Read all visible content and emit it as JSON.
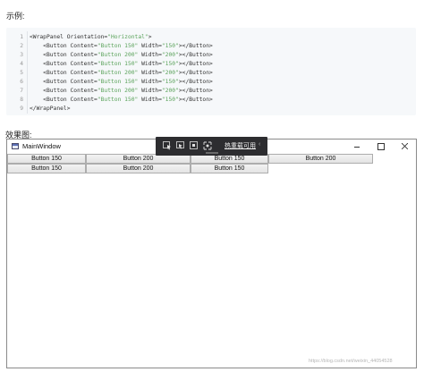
{
  "headings": {
    "example": "示例:",
    "effect": "效果图:"
  },
  "code": {
    "lines": [
      {
        "num": "1",
        "parts": [
          [
            "tag",
            "<WrapPanel "
          ],
          [
            "attr",
            "Orientation="
          ],
          [
            "str",
            "\"Horizontal\""
          ],
          [
            "tag",
            ">"
          ]
        ]
      },
      {
        "num": "2",
        "parts": [
          [
            "tag",
            "    <Button "
          ],
          [
            "attr",
            "Content="
          ],
          [
            "str",
            "\"Button 150\""
          ],
          [
            "attr",
            " Width="
          ],
          [
            "str",
            "\"150\""
          ],
          [
            "tag",
            "></Button>"
          ]
        ]
      },
      {
        "num": "3",
        "parts": [
          [
            "tag",
            "    <Button "
          ],
          [
            "attr",
            "Content="
          ],
          [
            "str",
            "\"Button 200\""
          ],
          [
            "attr",
            " Width="
          ],
          [
            "str",
            "\"200\""
          ],
          [
            "tag",
            "></Button>"
          ]
        ]
      },
      {
        "num": "4",
        "parts": [
          [
            "tag",
            "    <Button "
          ],
          [
            "attr",
            "Content="
          ],
          [
            "str",
            "\"Button 150\""
          ],
          [
            "attr",
            " Width="
          ],
          [
            "str",
            "\"150\""
          ],
          [
            "tag",
            "></Button>"
          ]
        ]
      },
      {
        "num": "5",
        "parts": [
          [
            "tag",
            "    <Button "
          ],
          [
            "attr",
            "Content="
          ],
          [
            "str",
            "\"Button 200\""
          ],
          [
            "attr",
            " Width="
          ],
          [
            "str",
            "\"200\""
          ],
          [
            "tag",
            "></Button>"
          ]
        ]
      },
      {
        "num": "6",
        "parts": [
          [
            "tag",
            "    <Button "
          ],
          [
            "attr",
            "Content="
          ],
          [
            "str",
            "\"Button 150\""
          ],
          [
            "attr",
            " Width="
          ],
          [
            "str",
            "\"150\""
          ],
          [
            "tag",
            "></Button>"
          ]
        ]
      },
      {
        "num": "7",
        "parts": [
          [
            "tag",
            "    <Button "
          ],
          [
            "attr",
            "Content="
          ],
          [
            "str",
            "\"Button 200\""
          ],
          [
            "attr",
            " Width="
          ],
          [
            "str",
            "\"200\""
          ],
          [
            "tag",
            "></Button>"
          ]
        ]
      },
      {
        "num": "8",
        "parts": [
          [
            "tag",
            "    <Button "
          ],
          [
            "attr",
            "Content="
          ],
          [
            "str",
            "\"Button 150\""
          ],
          [
            "attr",
            " Width="
          ],
          [
            "str",
            "\"150\""
          ],
          [
            "tag",
            "></Button>"
          ]
        ]
      },
      {
        "num": "9",
        "parts": [
          [
            "tag",
            "</WrapPanel>"
          ]
        ]
      }
    ]
  },
  "window": {
    "title": "MainWindow",
    "buttons": [
      {
        "label": "Button 150"
      },
      {
        "label": "Button 200"
      },
      {
        "label": "Button 150"
      },
      {
        "label": "Button 200"
      },
      {
        "label": "Button 150"
      },
      {
        "label": "Button 200"
      },
      {
        "label": "Button 150"
      }
    ]
  },
  "hot_reload": {
    "label": "热重载可用",
    "chevron": "‹",
    "icons": [
      "select-element-icon",
      "display-layout-icon",
      "track-focus-icon",
      "binding-failures-icon"
    ]
  },
  "watermark": "https://blog.csdn.net/weixin_44054528",
  "colors": {
    "toolbar_bg": "#2d2d30",
    "string_green": "#5aa25a",
    "code_bg": "#f6f8fa"
  }
}
